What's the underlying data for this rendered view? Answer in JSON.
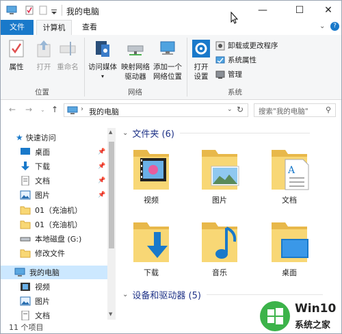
{
  "window": {
    "title": "我的电脑",
    "buttons": {
      "minimize": "—",
      "maximize": "☐",
      "close": "✕"
    }
  },
  "tabs": [
    {
      "label": "文件"
    },
    {
      "label": "计算机"
    },
    {
      "label": "查看"
    }
  ],
  "ribbon": {
    "location": {
      "label": "位置",
      "buttons": [
        {
          "label": "属性"
        },
        {
          "label": "打开"
        },
        {
          "label": "重命名"
        }
      ]
    },
    "network": {
      "label": "网络",
      "buttons": [
        {
          "line1": "访问媒体",
          "line2": ""
        },
        {
          "line1": "映射网络",
          "line2": "驱动器"
        },
        {
          "line1": "添加一个",
          "line2": "网络位置"
        }
      ]
    },
    "system": {
      "label": "系统",
      "open_settings": {
        "line1": "打开",
        "line2": "设置"
      },
      "items": [
        {
          "label": "卸载或更改程序"
        },
        {
          "label": "系统属性"
        },
        {
          "label": "管理"
        }
      ]
    }
  },
  "address": {
    "path": "我的电脑",
    "search_placeholder": "搜索\"我的电脑\""
  },
  "nav_pane": {
    "quick_access": "快速访问",
    "items": [
      {
        "label": "桌面",
        "pinned": true
      },
      {
        "label": "下载",
        "pinned": true
      },
      {
        "label": "文档",
        "pinned": true
      },
      {
        "label": "图片",
        "pinned": true
      },
      {
        "label": "01（充油机）",
        "pinned": false
      },
      {
        "label": "01（充油机）",
        "pinned": false
      },
      {
        "label": "本地磁盘 (G:)",
        "pinned": false
      },
      {
        "label": "修改文件",
        "pinned": false
      }
    ],
    "this_pc": "我的电脑",
    "pc_items": [
      {
        "label": "视频"
      },
      {
        "label": "图片"
      },
      {
        "label": "文档"
      }
    ]
  },
  "content": {
    "folders_header": "文件夹 (6)",
    "folders": [
      {
        "label": "视频"
      },
      {
        "label": "图片"
      },
      {
        "label": "文档"
      },
      {
        "label": "下载"
      },
      {
        "label": "音乐"
      },
      {
        "label": "桌面"
      }
    ],
    "devices_header": "设备和驱动器 (5)"
  },
  "status": {
    "items": "11 个项目"
  },
  "watermark": {
    "line1": "Win10",
    "line2": "系统之家"
  },
  "colors": {
    "accent": "#1979ca",
    "folder": "#f8d775",
    "folder_dark": "#e8b84a",
    "selection": "#cce8ff"
  }
}
